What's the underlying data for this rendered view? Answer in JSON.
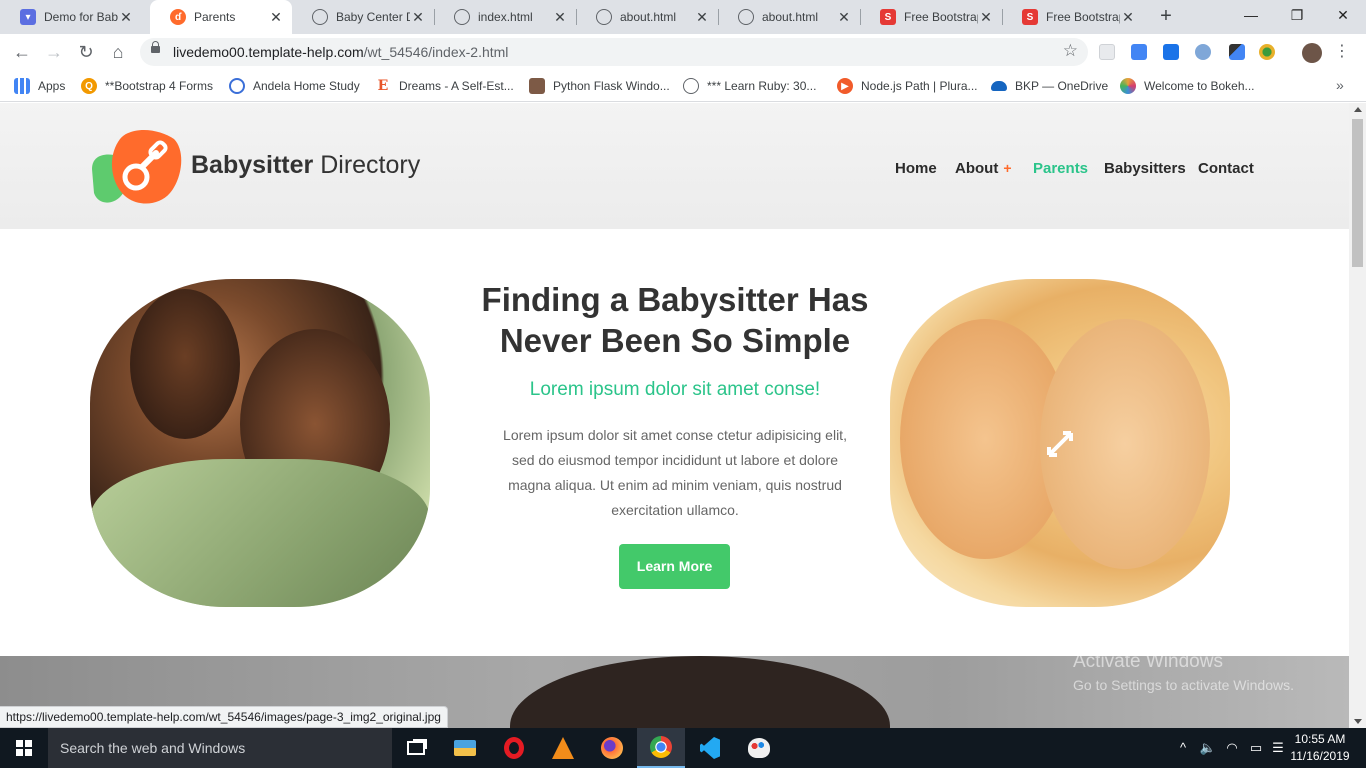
{
  "browser": {
    "tabs": [
      {
        "label": "Demo for Baby",
        "icon": "template-monster-icon",
        "color": "#5b6ee1",
        "active": false
      },
      {
        "label": "Parents",
        "icon": "babysitter-favicon",
        "color": "#ff6b2c",
        "active": true
      },
      {
        "label": "Baby Center Di",
        "icon": "globe-icon",
        "color": "#5f6368",
        "active": false
      },
      {
        "label": "index.html",
        "icon": "globe-icon",
        "color": "#5f6368",
        "active": false
      },
      {
        "label": "about.html",
        "icon": "globe-icon",
        "color": "#5f6368",
        "active": false
      },
      {
        "label": "about.html",
        "icon": "globe-icon",
        "color": "#5f6368",
        "active": false
      },
      {
        "label": "Free Bootstrap",
        "icon": "s-brand-icon",
        "color": "#e53935",
        "active": false
      },
      {
        "label": "Free Bootstrap",
        "icon": "s-brand-icon",
        "color": "#e53935",
        "active": false
      }
    ],
    "tab_close_glyph": "✕",
    "new_tab_glyph": "+",
    "window_controls": {
      "minimize": "—",
      "restore": "❐",
      "close": "✕"
    },
    "url_host": "livedemo00.template-help.com",
    "url_path": "/wt_54546/index-2.html",
    "bookmarks": [
      {
        "label": "Apps",
        "icon": "apps-grid-icon",
        "color": "#4285f4"
      },
      {
        "label": "**Bootstrap 4 Forms",
        "icon": "search-bookmark-icon",
        "color": "#f29900"
      },
      {
        "label": "Andela Home Study",
        "icon": "gear-bookmark-icon",
        "color": "#3b6fd8"
      },
      {
        "label": "Dreams - A Self-Est...",
        "icon": "letter-e-icon",
        "color": "#e8562a"
      },
      {
        "label": "Python Flask Windo...",
        "icon": "avatar-bookmark-icon",
        "color": "#7d5a46"
      },
      {
        "label": "*** Learn Ruby: 30...",
        "icon": "globe-icon",
        "color": "#5f6368"
      },
      {
        "label": "Node.js Path | Plura...",
        "icon": "pluralsight-icon",
        "color": "#f15b2a"
      },
      {
        "label": "BKP — OneDrive",
        "icon": "onedrive-icon",
        "color": "#1565c0"
      },
      {
        "label": "Welcome to Bokeh...",
        "icon": "bokeh-icon",
        "color": "#e8a23a"
      }
    ],
    "bookmarks_overflow": "»",
    "status_url": "https://livedemo00.template-help.com/wt_54546/images/page-3_img2_original.jpg"
  },
  "site": {
    "brand_bold": "Babysitter",
    "brand_light": " Directory",
    "nav": [
      {
        "label": "Home",
        "active": false
      },
      {
        "label": "About",
        "active": false,
        "has_submenu": true
      },
      {
        "label": "Parents",
        "active": true
      },
      {
        "label": "Babysitters",
        "active": false
      },
      {
        "label": "Contact",
        "active": false
      }
    ],
    "submenu_glyph": "+",
    "hero": {
      "title": "Finding a Babysitter Has Never Been So Simple",
      "subtitle": "Lorem ipsum dolor sit amet conse!",
      "text": "Lorem ipsum dolor sit amet conse ctetur adipisicing elit, sed do eiusmod tempor incididunt ut labore et dolore magna aliqua. Ut enim ad minim veniam, quis nostrud exercitation ullamco.",
      "button_label": "Learn More"
    },
    "colors": {
      "accent": "#2bc48a",
      "button": "#43c96a",
      "brand_orange": "#ff6b2c",
      "brand_green": "#5ecb6e"
    }
  },
  "os": {
    "watermark_title": "Activate Windows",
    "watermark_sub": "Go to Settings to activate Windows.",
    "search_placeholder": "Search the web and Windows",
    "taskbar_apps": [
      "task-view-icon",
      "file-explorer-icon",
      "opera-icon",
      "vlc-icon",
      "firefox-icon",
      "chrome-icon",
      "vscode-icon",
      "paint-icon"
    ],
    "clock_time": "10:55 AM",
    "clock_date": "11/16/2019"
  }
}
